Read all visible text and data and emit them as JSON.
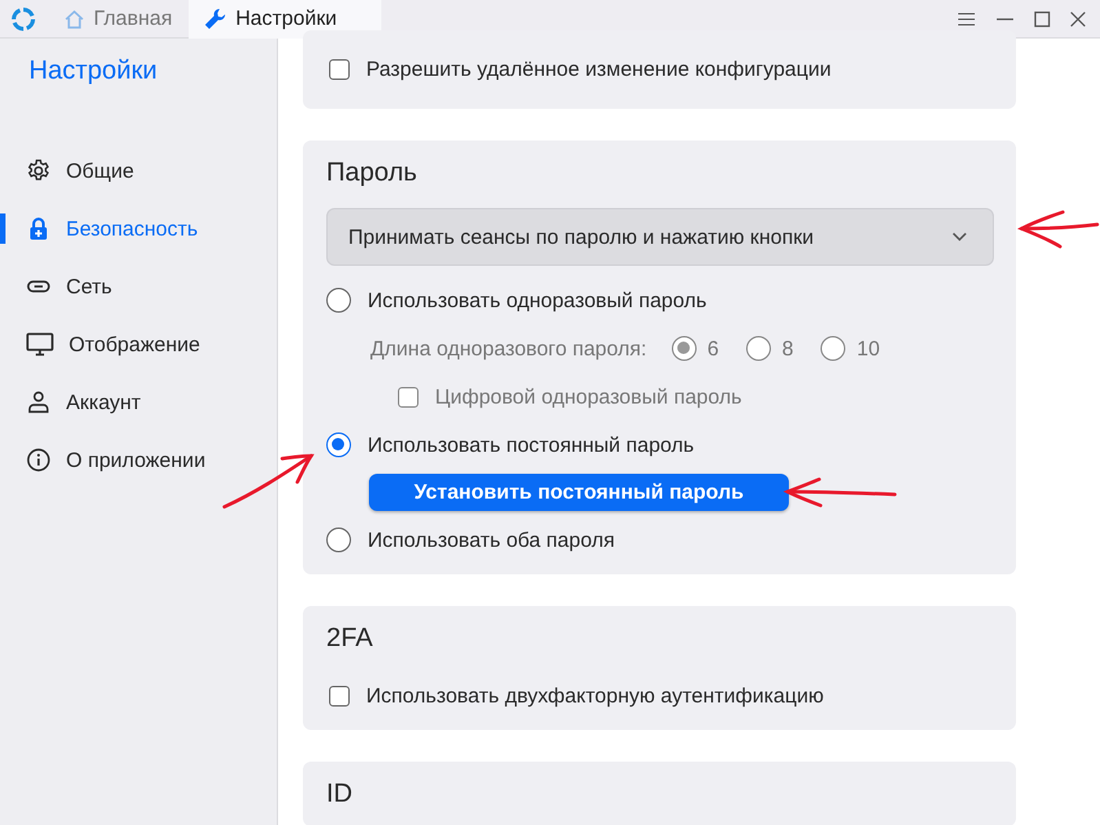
{
  "window": {
    "tabs": [
      {
        "label": "Главная",
        "selected": false,
        "kind": "home"
      },
      {
        "label": "Настройки",
        "selected": true,
        "kind": "wrench"
      }
    ]
  },
  "sidebar": {
    "title": "Настройки",
    "items": [
      {
        "label": "Общие",
        "selected": false,
        "kind": "gear"
      },
      {
        "label": "Безопасность",
        "selected": true,
        "kind": "lock"
      },
      {
        "label": "Сеть",
        "selected": false,
        "kind": "link"
      },
      {
        "label": "Отображение",
        "selected": false,
        "kind": "monitor"
      },
      {
        "label": "Аккаунт",
        "selected": false,
        "kind": "person"
      },
      {
        "label": "О приложении",
        "selected": false,
        "kind": "info"
      }
    ]
  },
  "remote_config": {
    "label": "Разрешить удалённое изменение конфигурации",
    "checked": false
  },
  "password": {
    "title": "Пароль",
    "dropdown": {
      "value": "Принимать сеансы по паролю и нажатию кнопки"
    },
    "otp": {
      "label": "Использовать одноразовый пароль",
      "selected": false,
      "length": {
        "label": "Длина одноразового пароля:",
        "disabled": true,
        "options": [
          {
            "label": "6",
            "selected": true
          },
          {
            "label": "8",
            "selected": false
          },
          {
            "label": "10",
            "selected": false
          }
        ]
      },
      "numeric": {
        "label": "Цифровой одноразовый пароль",
        "checked": false,
        "disabled": true
      }
    },
    "permanent": {
      "label": "Использовать постоянный пароль",
      "selected": true,
      "button": "Установить постоянный пароль"
    },
    "both": {
      "label": "Использовать оба пароля",
      "selected": false
    }
  },
  "twofa": {
    "title": "2FA",
    "checkbox": {
      "label": "Использовать двухфакторную аутентификацию",
      "checked": false
    }
  },
  "id_section": {
    "title": "ID"
  }
}
